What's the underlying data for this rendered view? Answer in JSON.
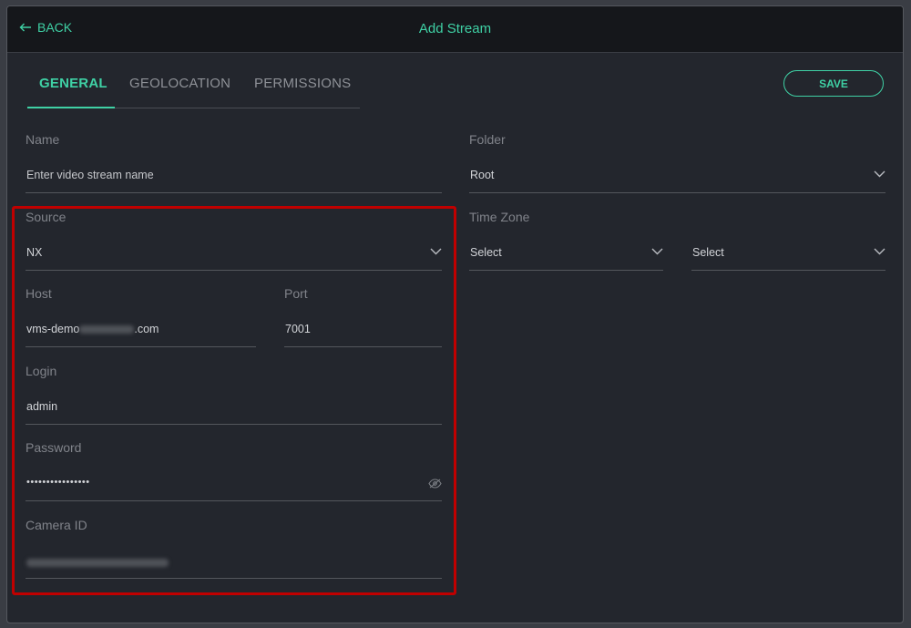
{
  "header": {
    "back_label": "BACK",
    "title": "Add Stream"
  },
  "tabs": [
    {
      "label": "GENERAL",
      "active": true
    },
    {
      "label": "GEOLOCATION",
      "active": false
    },
    {
      "label": "PERMISSIONS",
      "active": false
    }
  ],
  "save_label": "SAVE",
  "form": {
    "name": {
      "label": "Name",
      "placeholder": "Enter video stream name"
    },
    "folder": {
      "label": "Folder",
      "value": "Root"
    },
    "source": {
      "label": "Source",
      "value": "NX"
    },
    "timezone": {
      "label": "Time Zone",
      "region": "Select",
      "zone": "Select"
    },
    "host": {
      "label": "Host",
      "value_prefix": "vms-demo",
      "value_suffix": ".com"
    },
    "port": {
      "label": "Port",
      "value": "7001"
    },
    "login": {
      "label": "Login",
      "value": "admin"
    },
    "password": {
      "label": "Password",
      "value": "••••••••••••••••"
    },
    "camera_id": {
      "label": "Camera ID"
    }
  },
  "colors": {
    "accent": "#3fd1a5",
    "highlight": "#c00000",
    "background": "#23262d"
  },
  "icons": {
    "back": "arrow-left-icon",
    "dropdown": "chevron-down-icon",
    "password": "eye-icon"
  }
}
